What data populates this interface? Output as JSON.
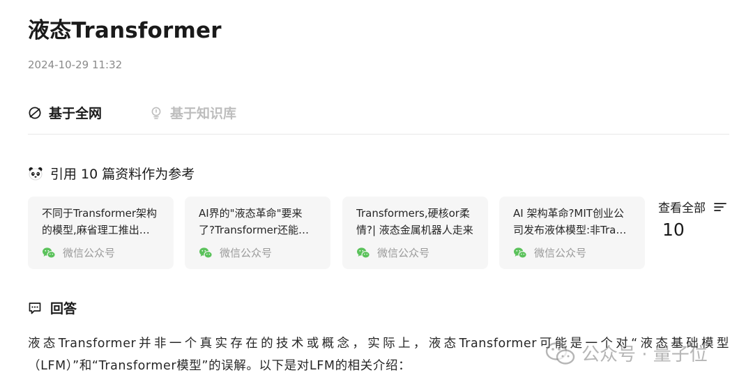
{
  "header": {
    "title": "液态Transformer",
    "timestamp": "2024-10-29 11:32"
  },
  "tabs": [
    {
      "label": "基于全网",
      "icon": "globe-icon",
      "active": true
    },
    {
      "label": "基于知识库",
      "icon": "lightbulb-icon",
      "active": false
    }
  ],
  "references": {
    "header": "引用 10 篇资料作为参考",
    "icon": "panda-icon",
    "cards": [
      {
        "title": "不同于Transformer架构的模型,麻省理工推出液态神经网络",
        "source": "微信公众号",
        "icon": "wechat-icon"
      },
      {
        "title": "AI界的\"液态革命\"要来了?Transformer还能撑多久",
        "source": "微信公众号",
        "icon": "wechat-icon"
      },
      {
        "title": "Transformers,硬核or柔情?| 液态金属机器人走来",
        "source": "微信公众号",
        "icon": "wechat-icon"
      },
      {
        "title": "AI 架构革命?MIT创业公司发布液体模型:非Transformer架构",
        "source": "微信公众号",
        "icon": "wechat-icon"
      }
    ],
    "view_all_label": "查看全部",
    "view_all_count": "10",
    "view_all_icon": "list-icon"
  },
  "answer": {
    "header": "回答",
    "icon": "chat-icon",
    "text": "液态Transformer并非一个真实存在的技术或概念，实际上，液态Transformer可能是一个对“液态基础模型（LFM）”和“Transformer模型”的误解。以下是对LFM的相关介绍："
  },
  "watermark": {
    "text": "公众号 · 量子位",
    "icon": "wechat-icon"
  },
  "colors": {
    "wechat_green": "#5bc25b",
    "muted_text": "#9a9a9a",
    "card_bg": "#f6f6f6"
  }
}
